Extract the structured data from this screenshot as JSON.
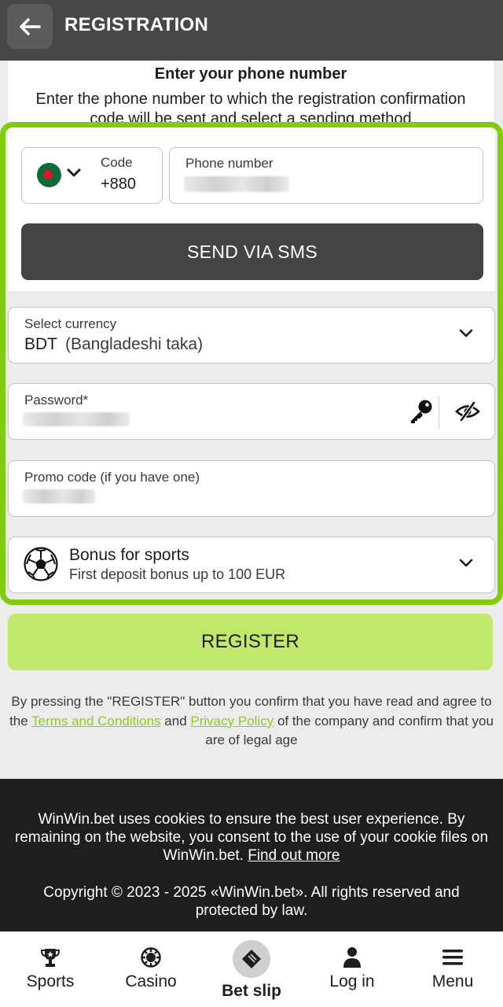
{
  "header": {
    "title": "REGISTRATION"
  },
  "intro": {
    "title": "Enter your phone number",
    "description": "Enter the phone number to which the registration confirmation code will be sent and select a sending method"
  },
  "phone": {
    "code_label": "Code",
    "code_value": "+880",
    "number_label": "Phone number",
    "send_button": "SEND VIA SMS"
  },
  "currency": {
    "label": "Select currency",
    "code": "BDT",
    "name": "(Bangladeshi taka)"
  },
  "password": {
    "label": "Password*"
  },
  "promo": {
    "label": "Promo code (if you have one)"
  },
  "bonus": {
    "title": "Bonus for sports",
    "subtitle": "First deposit bonus up to 100 EUR"
  },
  "register_button": "REGISTER",
  "legal": {
    "part1": "By pressing the \"REGISTER\" button you confirm that you have read and agree to the",
    "terms_link": "Terms and Conditions",
    "and": "and",
    "privacy_link": "Privacy Policy",
    "part2": "of the company and confirm that you are of legal age"
  },
  "footer": {
    "cookie_text": "WinWin.bet uses cookies to ensure the best user experience. By remaining on the website, you consent to the use of your cookie files on WinWin.bet.",
    "find_out_more": "Find out more",
    "copyright": "Copyright © 2023 - 2025 «WinWin.bet». All rights reserved and protected by law."
  },
  "nav": {
    "sports": "Sports",
    "casino": "Casino",
    "bet_slip": "Bet slip",
    "log_in": "Log in",
    "menu": "Menu"
  },
  "colors": {
    "accent_green": "#82cc0f",
    "register_bg": "#c1e86a",
    "header_bg": "#474747",
    "footer_bg": "#1e1e1e"
  }
}
